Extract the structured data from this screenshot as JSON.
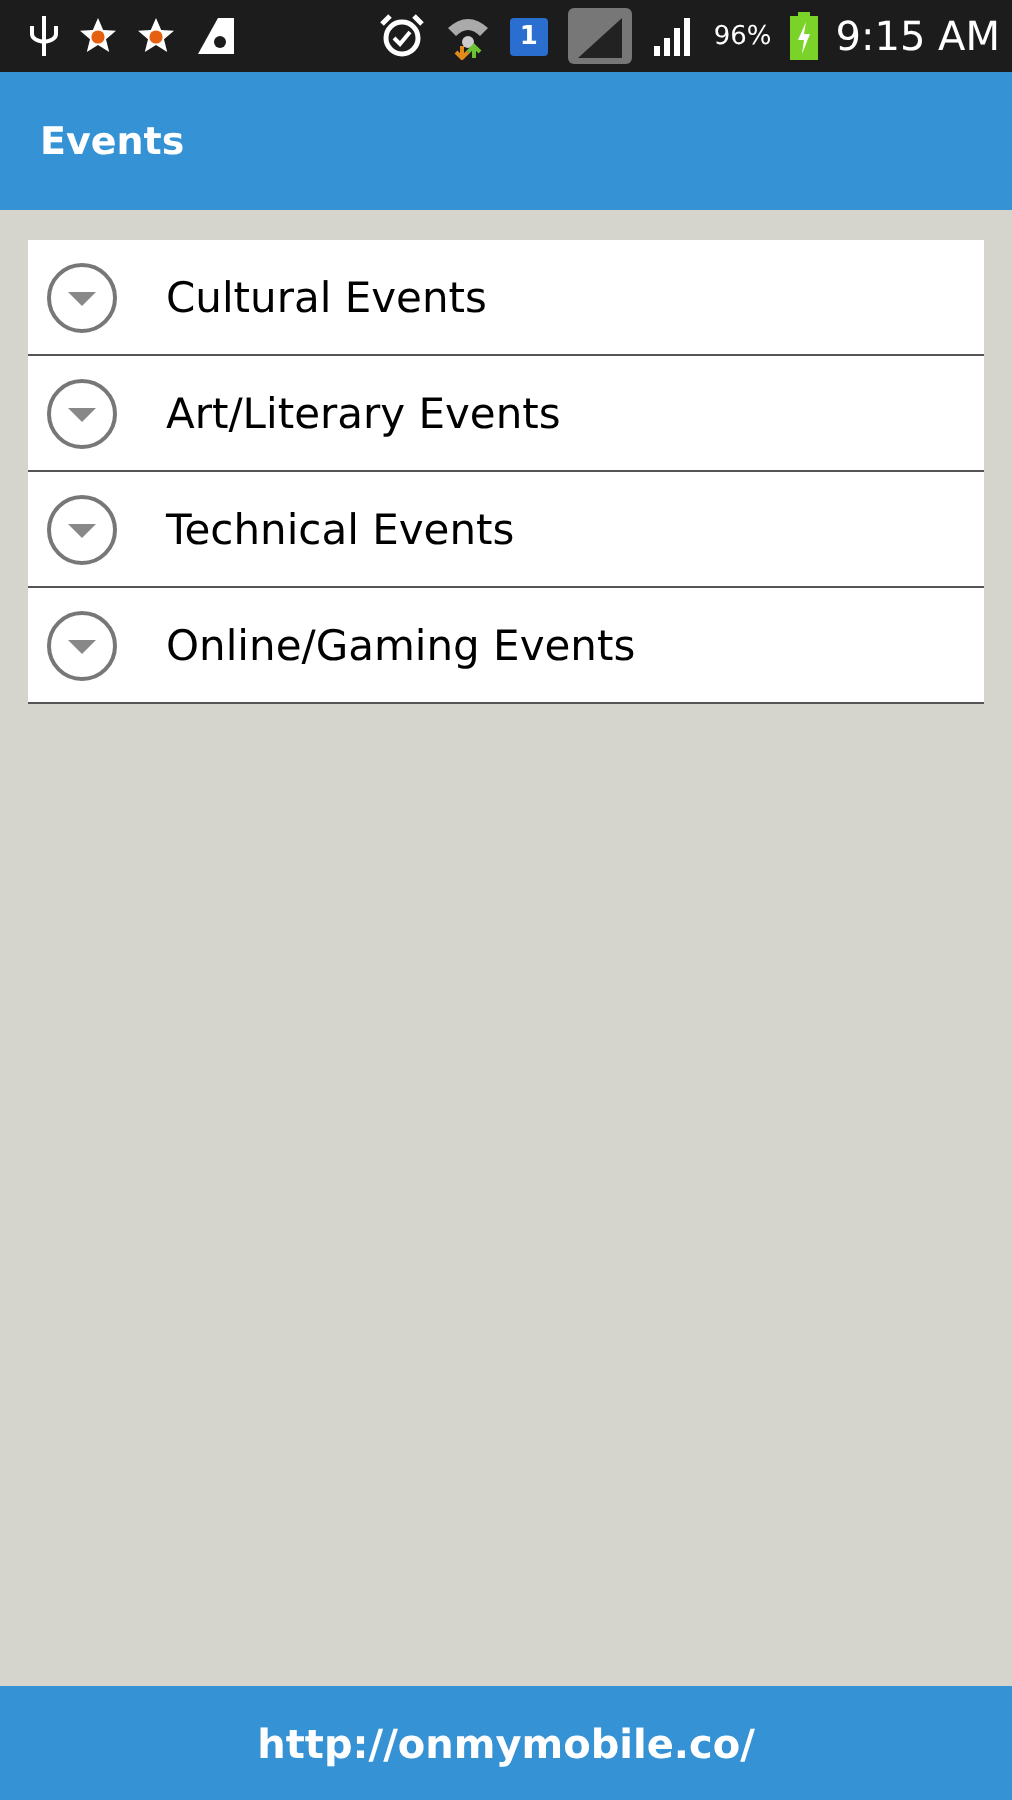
{
  "status_bar": {
    "sim_slot": "1",
    "battery": "96%",
    "time": "9:15 AM"
  },
  "header": {
    "title": "Events"
  },
  "groups": [
    {
      "label": "Cultural Events",
      "expanded": false
    },
    {
      "label": "Art/Literary Events",
      "expanded": false
    },
    {
      "label": "Technical Events",
      "expanded": false
    },
    {
      "label": "Online/Gaming Events",
      "expanded": false
    }
  ],
  "footer": {
    "link": "http://onmymobile.co/"
  }
}
